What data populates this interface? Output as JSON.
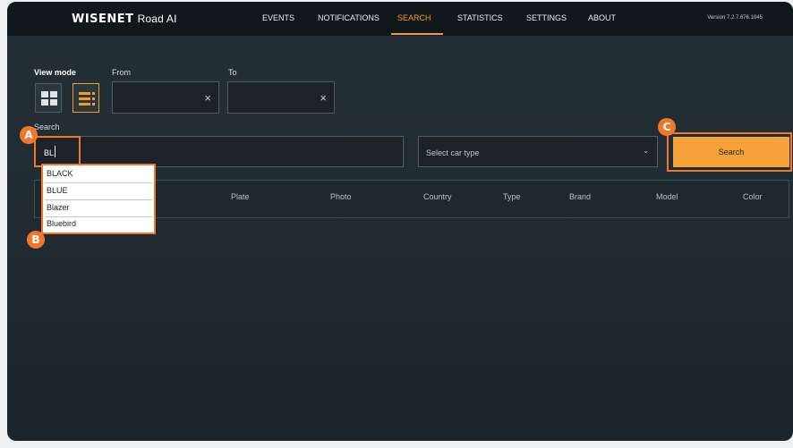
{
  "app": {
    "brand_logo": "WISENET",
    "brand_product": "Road AI",
    "version": "Version 7.2.7.676.1045"
  },
  "nav": [
    {
      "label": "EVENTS",
      "active": false
    },
    {
      "label": "NOTIFICATIONS",
      "active": false
    },
    {
      "label": "SEARCH",
      "active": true
    },
    {
      "label": "STATISTICS",
      "active": false
    },
    {
      "label": "SETTINGS",
      "active": false
    },
    {
      "label": "ABOUT",
      "active": false
    }
  ],
  "filters": {
    "view_mode_label": "View mode",
    "view_modes": [
      {
        "icon": "grid-view-icon",
        "active": false
      },
      {
        "icon": "list-view-icon",
        "active": true
      }
    ],
    "from_label": "From",
    "to_label": "To",
    "from_value": "",
    "to_value": "",
    "clear_icon": "×"
  },
  "search": {
    "label": "Search",
    "value": "BL",
    "suggestions": [
      "BLACK",
      "BLUE",
      "Blazer",
      "Bluebird"
    ]
  },
  "car_type": {
    "placeholder": "Select car type",
    "chevron": "⌄"
  },
  "search_button": {
    "label": "Search"
  },
  "results": {
    "columns": [
      "Plate",
      "Photo",
      "Country",
      "Type",
      "Brand",
      "Model",
      "Color"
    ]
  },
  "callouts": [
    "A",
    "B",
    "C"
  ],
  "colors": {
    "accent": "#f39a2a",
    "highlight": "#f0782a",
    "background": "#222d34",
    "topbar": "#11181c"
  }
}
